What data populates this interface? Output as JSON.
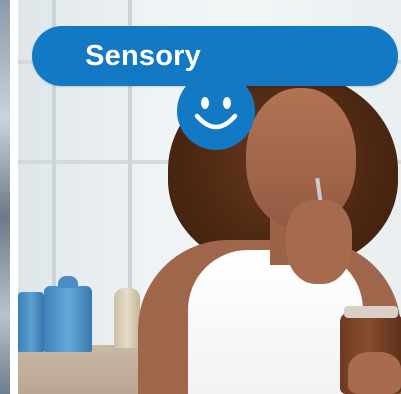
{
  "badge": {
    "label": "Sensory",
    "icon": "smiley-face-icon",
    "color": "#1479c4",
    "text_color": "#ffffff"
  }
}
